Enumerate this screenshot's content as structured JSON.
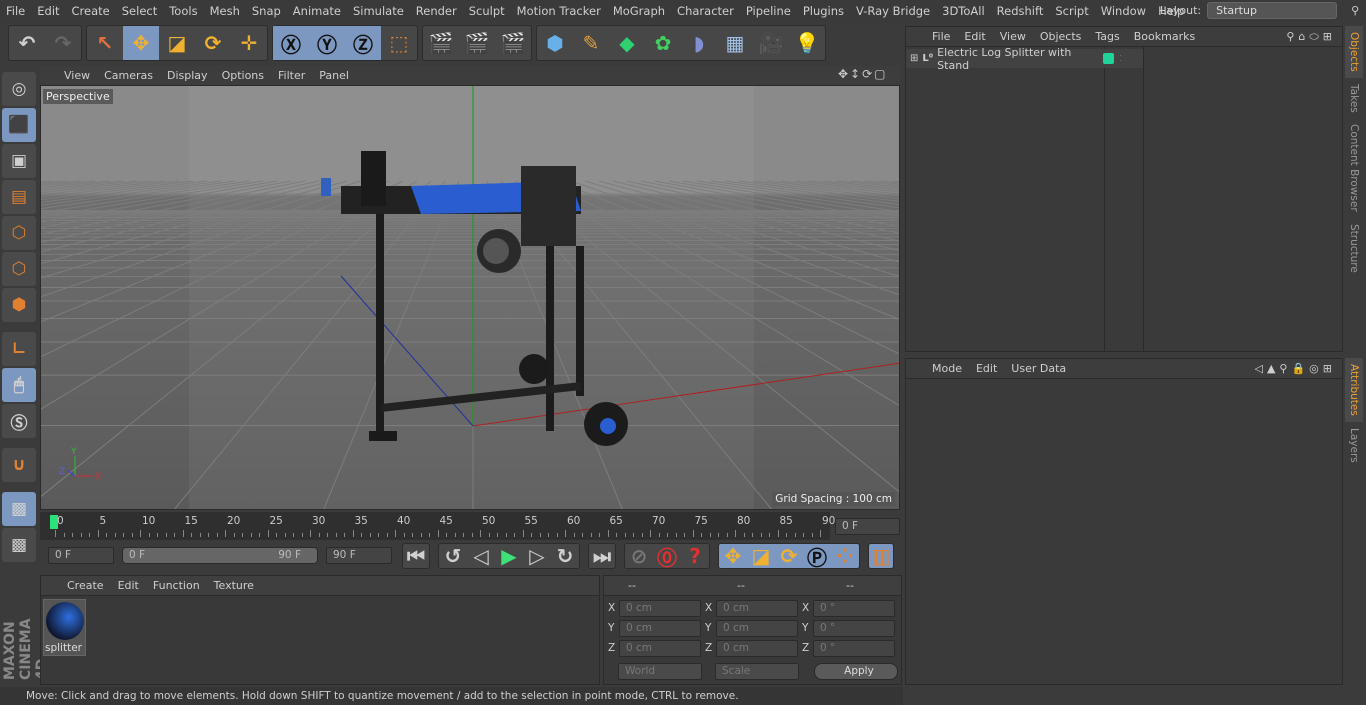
{
  "menu": [
    "File",
    "Edit",
    "Create",
    "Select",
    "Tools",
    "Mesh",
    "Snap",
    "Animate",
    "Simulate",
    "Render",
    "Sculpt",
    "Motion Tracker",
    "MoGraph",
    "Character",
    "Pipeline",
    "Plugins",
    "V-Ray Bridge",
    "3DToAll",
    "Redshift",
    "Script",
    "Window",
    "Help"
  ],
  "layout": {
    "label": "Layout:",
    "value": "Startup"
  },
  "viewport": {
    "menu": [
      "View",
      "Cameras",
      "Display",
      "Options",
      "Filter",
      "Panel"
    ],
    "label": "Perspective",
    "grid_spacing": "Grid Spacing : 100 cm"
  },
  "objects": {
    "menu": [
      "File",
      "Edit",
      "View",
      "Objects",
      "Tags",
      "Bookmarks"
    ],
    "item": "Electric Log Splitter with Stand",
    "item_color": "#1fd39a"
  },
  "right_tabs": [
    "Objects",
    "Takes",
    "Content Browser",
    "Structure"
  ],
  "attr_tabs": [
    "Attributes",
    "Layers"
  ],
  "attributes": {
    "menu": [
      "Mode",
      "Edit",
      "User Data"
    ]
  },
  "timeline": {
    "ticks": [
      "0",
      "5",
      "10",
      "15",
      "20",
      "25",
      "30",
      "35",
      "40",
      "45",
      "50",
      "55",
      "60",
      "65",
      "70",
      "75",
      "80",
      "85",
      "90"
    ],
    "current": "0 F",
    "start": "0 F",
    "range_start": "0 F",
    "range_end": "90 F",
    "end": "90 F"
  },
  "materials": {
    "menu": [
      "Create",
      "Edit",
      "Function",
      "Texture"
    ],
    "items": [
      {
        "name": "splitter"
      }
    ]
  },
  "coords": {
    "headers": [
      "--",
      "--",
      "--"
    ],
    "rows": [
      {
        "axis": "X",
        "pos": "0 cm",
        "size": "0 cm",
        "rot": "0 °"
      },
      {
        "axis": "Y",
        "pos": "0 cm",
        "size": "0 cm",
        "rot": "0 °"
      },
      {
        "axis": "Z",
        "pos": "0 cm",
        "size": "0 cm",
        "rot": "0 °"
      }
    ],
    "space": "World",
    "mode": "Scale",
    "apply": "Apply"
  },
  "brand": "MAXON CINEMA 4D",
  "status": "Move: Click and drag to move elements. Hold down SHIFT to quantize movement / add to the selection in point mode, CTRL to remove."
}
